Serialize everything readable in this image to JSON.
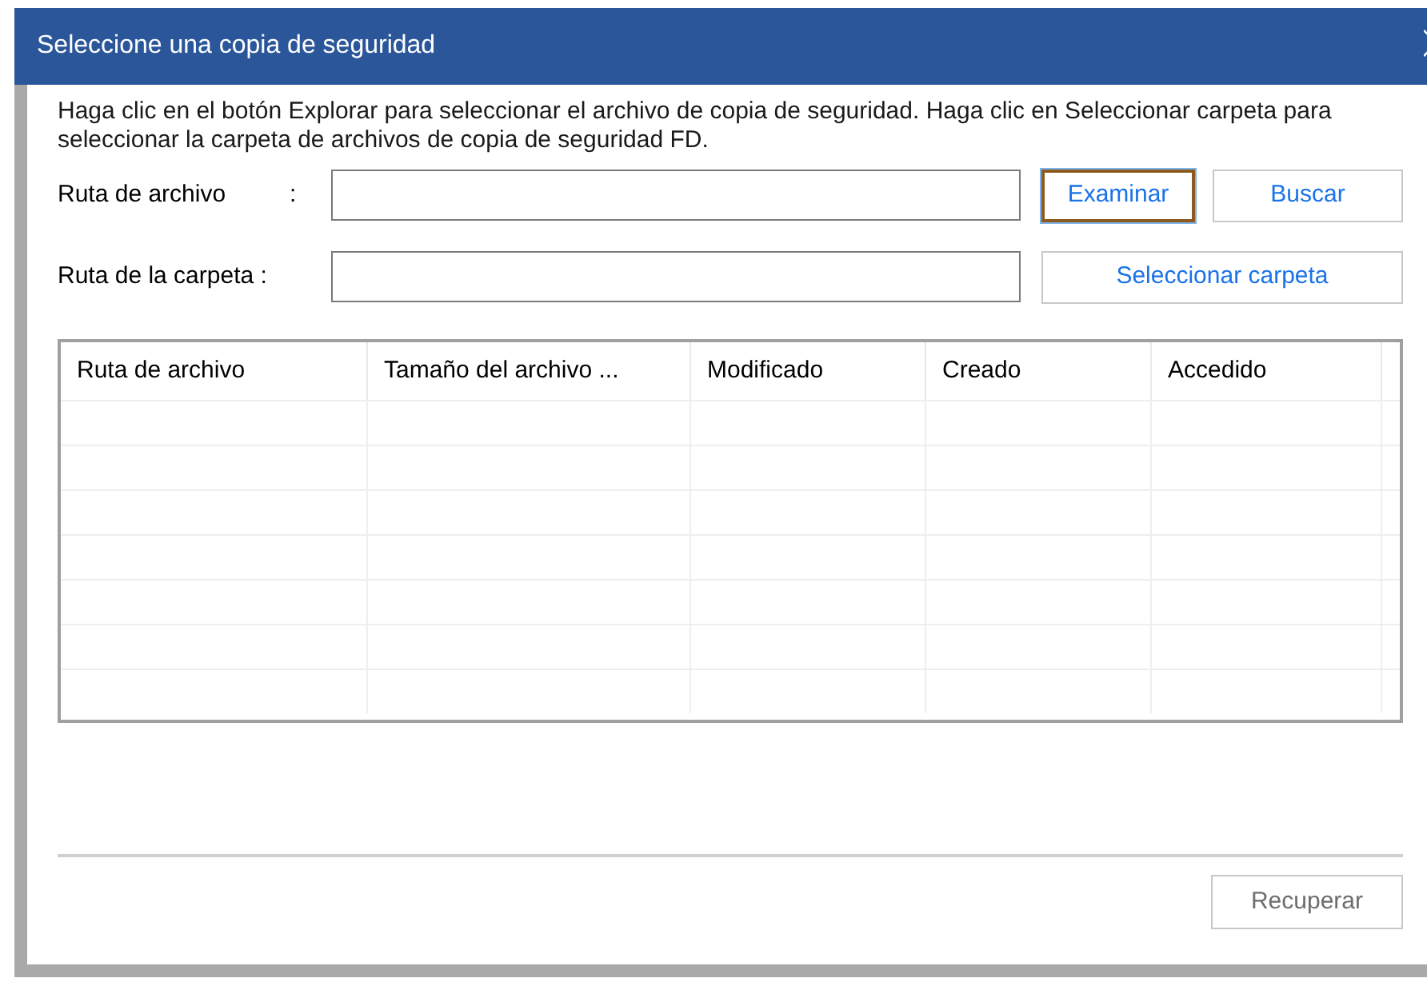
{
  "window": {
    "title": "Seleccione una copia de seguridad"
  },
  "instructions": "Haga clic en el botón Explorar para seleccionar el archivo de copia de seguridad. Haga clic en Seleccionar carpeta para seleccionar la carpeta de archivos de copia de seguridad FD.",
  "file_path": {
    "label": "Ruta de archivo",
    "colon": ":",
    "buttons": [
      {
        "label": "Examinar",
        "focused": true
      },
      {
        "label": "Buscar",
        "focused": false
      }
    ]
  },
  "folder_path": {
    "label": "Ruta de la carpeta :",
    "button": "Seleccionar carpeta"
  },
  "table": {
    "columns": [
      "Ruta de archivo",
      "Tamaño del archivo ...",
      "Modificado",
      "Creado",
      "Accedido"
    ]
  },
  "recover_button": {
    "label": "Recuperar",
    "disabled": true
  }
}
